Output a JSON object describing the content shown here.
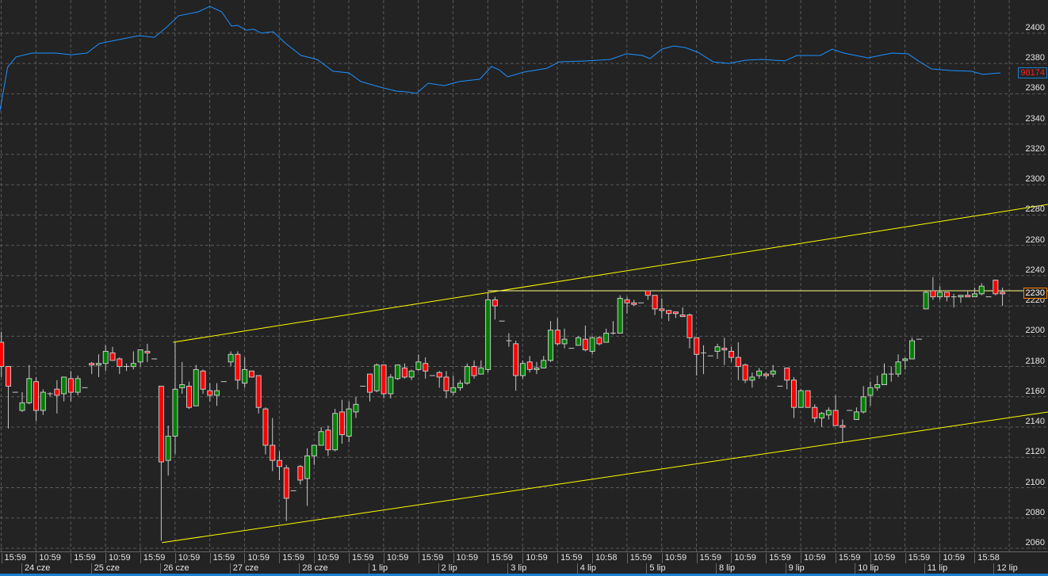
{
  "colors": {
    "background": "#232323",
    "grid": "#5a5a5a",
    "up": "#008000",
    "down": "#ff0000",
    "candle_border": "#c8c8c8",
    "indicator": "#1e90ff",
    "channel": "#ffff00",
    "level_line": "#ffff80",
    "bottom_bar": "#1a7fd0"
  },
  "badges": {
    "indicator_value": "98174",
    "level_price": "2230"
  },
  "chart_data": {
    "type": "candlestick",
    "title": "",
    "ylim": [
      2055,
      2420
    ],
    "yticks": [
      "2060",
      "2080",
      "2100",
      "2120",
      "2140",
      "2160",
      "2180",
      "2200",
      "2220",
      "2240",
      "2260",
      "2280",
      "2300",
      "2320",
      "2340",
      "2360",
      "2380",
      "2400"
    ],
    "time_labels": [
      "15:59",
      "10:59",
      "15:59",
      "10:59",
      "15:59",
      "10:59",
      "15:59",
      "10:59",
      "15:59",
      "10:59",
      "15:59",
      "10:59",
      "15:59",
      "10:59",
      "15:59",
      "10:59",
      "15:59",
      "10:58",
      "15:59",
      "10:59",
      "15:59",
      "10:59",
      "15:59",
      "10:59",
      "15:59",
      "10:59",
      "15:59",
      "10:59",
      "15:58"
    ],
    "date_labels": [
      "24 cze",
      "25 cze",
      "26 cze",
      "27 cze",
      "28 cze",
      "1 lip",
      "2 lip",
      "3 lip",
      "4 lip",
      "5 lip",
      "8 lip",
      "9 lip",
      "10 lip",
      "11 lip",
      "12 lip"
    ],
    "ohlc_fields": [
      "open",
      "high",
      "low",
      "close"
    ],
    "candles": [
      [
        2196,
        2203,
        2173,
        2180
      ],
      [
        2180,
        2180,
        2139,
        2167
      ],
      [
        2163,
        2163,
        2163,
        2163
      ],
      [
        2151,
        2163,
        2150,
        2156
      ],
      [
        2156,
        2181,
        2155,
        2172
      ],
      [
        2170,
        2173,
        2144,
        2151
      ],
      [
        2151,
        2165,
        2148,
        2163
      ],
      [
        2162,
        2163,
        2160,
        2162
      ],
      [
        2165,
        2171,
        2149,
        2161
      ],
      [
        2162,
        2173,
        2157,
        2173
      ],
      [
        2172,
        2177,
        2157,
        2163
      ],
      [
        2163,
        2174,
        2161,
        2172
      ],
      [
        2166,
        2166,
        2166,
        2166
      ],
      [
        2182,
        2183,
        2175,
        2181
      ],
      [
        2181,
        2188,
        2173,
        2182
      ],
      [
        2182,
        2194,
        2177,
        2190
      ],
      [
        2189,
        2193,
        2184,
        2184
      ],
      [
        2185,
        2186,
        2175,
        2180
      ],
      [
        2180,
        2182,
        2177,
        2180
      ],
      [
        2180,
        2190,
        2178,
        2182
      ],
      [
        2183,
        2191,
        2180,
        2191
      ],
      [
        2190,
        2195,
        2183,
        2189
      ],
      [
        2185,
        2185,
        2185,
        2185
      ],
      [
        2167,
        2167,
        2065,
        2117
      ],
      [
        2118,
        2141,
        2108,
        2134
      ],
      [
        2134,
        2196,
        2122,
        2165
      ],
      [
        2166,
        2183,
        2162,
        2168
      ],
      [
        2167,
        2170,
        2152,
        2153
      ],
      [
        2154,
        2181,
        2154,
        2178
      ],
      [
        2177,
        2178,
        2162,
        2165
      ],
      [
        2164,
        2169,
        2157,
        2161
      ],
      [
        2161,
        2169,
        2154,
        2164
      ],
      [
        2170,
        2170,
        2170,
        2170
      ],
      [
        2183,
        2190,
        2180,
        2188
      ],
      [
        2188,
        2190,
        2165,
        2171
      ],
      [
        2169,
        2186,
        2166,
        2178
      ],
      [
        2177,
        2177,
        2173,
        2173
      ],
      [
        2174,
        2174,
        2149,
        2153
      ],
      [
        2152,
        2153,
        2122,
        2128
      ],
      [
        2128,
        2146,
        2111,
        2118
      ],
      [
        2118,
        2124,
        2105,
        2114
      ],
      [
        2113,
        2115,
        2078,
        2093
      ],
      [
        2098,
        2098,
        2098,
        2098
      ],
      [
        2114,
        2115,
        2102,
        2105
      ],
      [
        2106,
        2126,
        2088,
        2121
      ],
      [
        2121,
        2128,
        2115,
        2128
      ],
      [
        2128,
        2140,
        2128,
        2137
      ],
      [
        2138,
        2141,
        2121,
        2125
      ],
      [
        2125,
        2152,
        2124,
        2149
      ],
      [
        2150,
        2158,
        2129,
        2135
      ],
      [
        2134,
        2157,
        2130,
        2152
      ],
      [
        2150,
        2160,
        2146,
        2155
      ],
      [
        2167,
        2167,
        2167,
        2167
      ],
      [
        2175,
        2175,
        2157,
        2163
      ],
      [
        2164,
        2182,
        2163,
        2181
      ],
      [
        2181,
        2181,
        2159,
        2162
      ],
      [
        2162,
        2175,
        2159,
        2173
      ],
      [
        2172,
        2181,
        2171,
        2181
      ],
      [
        2179,
        2182,
        2172,
        2173
      ],
      [
        2173,
        2178,
        2171,
        2177
      ],
      [
        2178,
        2188,
        2177,
        2183
      ],
      [
        2182,
        2186,
        2172,
        2177
      ],
      [
        2174,
        2174,
        2174,
        2174
      ],
      [
        2176,
        2177,
        2166,
        2173
      ],
      [
        2173,
        2177,
        2159,
        2164
      ],
      [
        2163,
        2174,
        2161,
        2166
      ],
      [
        2166,
        2171,
        2164,
        2169
      ],
      [
        2169,
        2182,
        2168,
        2180
      ],
      [
        2180,
        2184,
        2172,
        2174
      ],
      [
        2175,
        2184,
        2175,
        2179
      ],
      [
        2178,
        2229,
        2176,
        2224
      ],
      [
        2224,
        2226,
        2211,
        2220
      ],
      [
        2210,
        2210,
        2210,
        2210
      ],
      [
        2197,
        2202,
        2193,
        2197
      ],
      [
        2195,
        2197,
        2164,
        2174
      ],
      [
        2174,
        2184,
        2172,
        2182
      ],
      [
        2183,
        2187,
        2176,
        2178
      ],
      [
        2178,
        2183,
        2175,
        2179
      ],
      [
        2179,
        2187,
        2179,
        2184
      ],
      [
        2184,
        2210,
        2183,
        2204
      ],
      [
        2204,
        2212,
        2194,
        2195
      ],
      [
        2195,
        2205,
        2192,
        2198
      ],
      [
        2192,
        2192,
        2192,
        2192
      ],
      [
        2194,
        2200,
        2194,
        2199
      ],
      [
        2198,
        2207,
        2190,
        2191
      ],
      [
        2190,
        2200,
        2188,
        2199
      ],
      [
        2199,
        2200,
        2194,
        2195
      ],
      [
        2196,
        2205,
        2196,
        2202
      ],
      [
        2202,
        2210,
        2201,
        2202
      ],
      [
        2202,
        2227,
        2202,
        2225
      ],
      [
        2224,
        2226,
        2215,
        2222
      ],
      [
        2222,
        2224,
        2220,
        2221
      ],
      [
        2222,
        2222,
        2222,
        2222
      ],
      [
        2230,
        2230,
        2224,
        2227
      ],
      [
        2227,
        2227,
        2214,
        2218
      ],
      [
        2218,
        2225,
        2212,
        2217
      ],
      [
        2217,
        2217,
        2210,
        2215
      ],
      [
        2216,
        2216,
        2212,
        2215
      ],
      [
        2214,
        2219,
        2213,
        2213
      ],
      [
        2214,
        2215,
        2192,
        2199
      ],
      [
        2199,
        2199,
        2174,
        2188
      ],
      [
        2189,
        2194,
        2175,
        2189
      ],
      [
        2187,
        2187,
        2187,
        2187
      ],
      [
        2190,
        2195,
        2185,
        2193
      ],
      [
        2192,
        2199,
        2181,
        2191
      ],
      [
        2190,
        2193,
        2183,
        2186
      ],
      [
        2186,
        2196,
        2171,
        2180
      ],
      [
        2181,
        2182,
        2169,
        2171
      ],
      [
        2171,
        2176,
        2166,
        2173
      ],
      [
        2174,
        2179,
        2172,
        2177
      ],
      [
        2175,
        2176,
        2172,
        2174
      ],
      [
        2175,
        2181,
        2173,
        2177
      ],
      [
        2167,
        2167,
        2167,
        2167
      ],
      [
        2179,
        2179,
        2165,
        2171
      ],
      [
        2171,
        2173,
        2146,
        2153
      ],
      [
        2153,
        2165,
        2153,
        2164
      ],
      [
        2164,
        2164,
        2153,
        2153
      ],
      [
        2153,
        2155,
        2143,
        2146
      ],
      [
        2146,
        2150,
        2140,
        2149
      ],
      [
        2148,
        2153,
        2145,
        2151
      ],
      [
        2151,
        2161,
        2141,
        2141
      ],
      [
        2141,
        2145,
        2130,
        2140
      ],
      [
        2151,
        2151,
        2151,
        2151
      ],
      [
        2145,
        2153,
        2145,
        2150
      ],
      [
        2150,
        2167,
        2149,
        2160
      ],
      [
        2161,
        2170,
        2154,
        2166
      ],
      [
        2166,
        2174,
        2164,
        2168
      ],
      [
        2168,
        2182,
        2168,
        2175
      ],
      [
        2175,
        2180,
        2170,
        2175
      ],
      [
        2175,
        2188,
        2173,
        2183
      ],
      [
        2184,
        2186,
        2178,
        2185
      ],
      [
        2185,
        2199,
        2185,
        2197
      ],
      [
        2198,
        2198,
        2198,
        2198
      ],
      [
        2218,
        2230,
        2218,
        2229
      ],
      [
        2230,
        2239,
        2224,
        2226
      ],
      [
        2226,
        2233,
        2224,
        2229
      ],
      [
        2229,
        2229,
        2223,
        2226
      ],
      [
        2226,
        2228,
        2219,
        2226
      ],
      [
        2226,
        2227,
        2222,
        2227
      ],
      [
        2227,
        2230,
        2226,
        2226
      ],
      [
        2226,
        2232,
        2226,
        2228
      ],
      [
        2228,
        2235,
        2227,
        2233
      ],
      [
        2226,
        2226,
        2226,
        2226
      ],
      [
        2237,
        2237,
        2227,
        2228
      ],
      [
        2229,
        2232,
        2220,
        2228
      ]
    ],
    "indicator_series": {
      "name": "98174",
      "points": [
        [
          -0.2,
          2348.7
        ],
        [
          0.4,
          2364.4
        ],
        [
          0.9,
          2377.5
        ],
        [
          2.1,
          2384.3
        ],
        [
          4.4,
          2386.9
        ],
        [
          7.8,
          2386.9
        ],
        [
          10.1,
          2385.8
        ],
        [
          12.3,
          2386.9
        ],
        [
          14.1,
          2393.2
        ],
        [
          16.9,
          2395.8
        ],
        [
          19.8,
          2398.4
        ],
        [
          22.0,
          2397.3
        ],
        [
          23.7,
          2403.6
        ],
        [
          25.5,
          2411.5
        ],
        [
          28.3,
          2414.1
        ],
        [
          30.0,
          2417.7
        ],
        [
          31.7,
          2414.1
        ],
        [
          33.1,
          2404.7
        ],
        [
          34.0,
          2405.2
        ],
        [
          35.2,
          2402.0
        ],
        [
          36.3,
          2402.6
        ],
        [
          37.4,
          2400.0
        ],
        [
          39.1,
          2401.0
        ],
        [
          40.9,
          2393.2
        ],
        [
          43.1,
          2385.3
        ],
        [
          45.4,
          2382.7
        ],
        [
          47.7,
          2374.9
        ],
        [
          50.0,
          2373.8
        ],
        [
          51.7,
          2368.1
        ],
        [
          54.5,
          2364.4
        ],
        [
          56.8,
          2361.8
        ],
        [
          58.5,
          2361.2
        ],
        [
          59.7,
          2360.2
        ],
        [
          61.4,
          2367.0
        ],
        [
          63.7,
          2365.4
        ],
        [
          65.9,
          2368.1
        ],
        [
          68.8,
          2369.6
        ],
        [
          70.5,
          2378.0
        ],
        [
          71.6,
          2375.9
        ],
        [
          72.8,
          2371.2
        ],
        [
          75.1,
          2374.3
        ],
        [
          78.5,
          2376.9
        ],
        [
          80.2,
          2381.1
        ],
        [
          84.2,
          2381.7
        ],
        [
          87.6,
          2382.7
        ],
        [
          89.9,
          2386.4
        ],
        [
          92.2,
          2385.3
        ],
        [
          93.3,
          2383.2
        ],
        [
          95.0,
          2389.5
        ],
        [
          96.7,
          2391.6
        ],
        [
          98.4,
          2390.5
        ],
        [
          100.2,
          2387.4
        ],
        [
          102.4,
          2381.1
        ],
        [
          104.7,
          2380.1
        ],
        [
          107.0,
          2382.2
        ],
        [
          109.3,
          2382.7
        ],
        [
          112.7,
          2381.7
        ],
        [
          114.4,
          2385.3
        ],
        [
          116.1,
          2385.3
        ],
        [
          117.8,
          2385.3
        ],
        [
          119.5,
          2389.5
        ],
        [
          121.2,
          2386.9
        ],
        [
          122.9,
          2385.3
        ],
        [
          124.7,
          2383.7
        ],
        [
          126.4,
          2385.3
        ],
        [
          128.1,
          2386.9
        ],
        [
          130.4,
          2386.4
        ],
        [
          132.1,
          2381.1
        ],
        [
          133.8,
          2376.4
        ],
        [
          136.6,
          2375.4
        ],
        [
          139.5,
          2374.9
        ],
        [
          141.2,
          2372.8
        ],
        [
          143.7,
          2373.8
        ]
      ]
    },
    "channel_lines": [
      {
        "name": "upper",
        "from": [
          24.7,
          2196
        ],
        "to": [
          150.6,
          2287
        ]
      },
      {
        "name": "lower",
        "from": [
          23.1,
          2063.7
        ],
        "to": [
          150.6,
          2150
        ]
      }
    ],
    "level_line": {
      "price": 2230,
      "from_index": 70
    }
  }
}
